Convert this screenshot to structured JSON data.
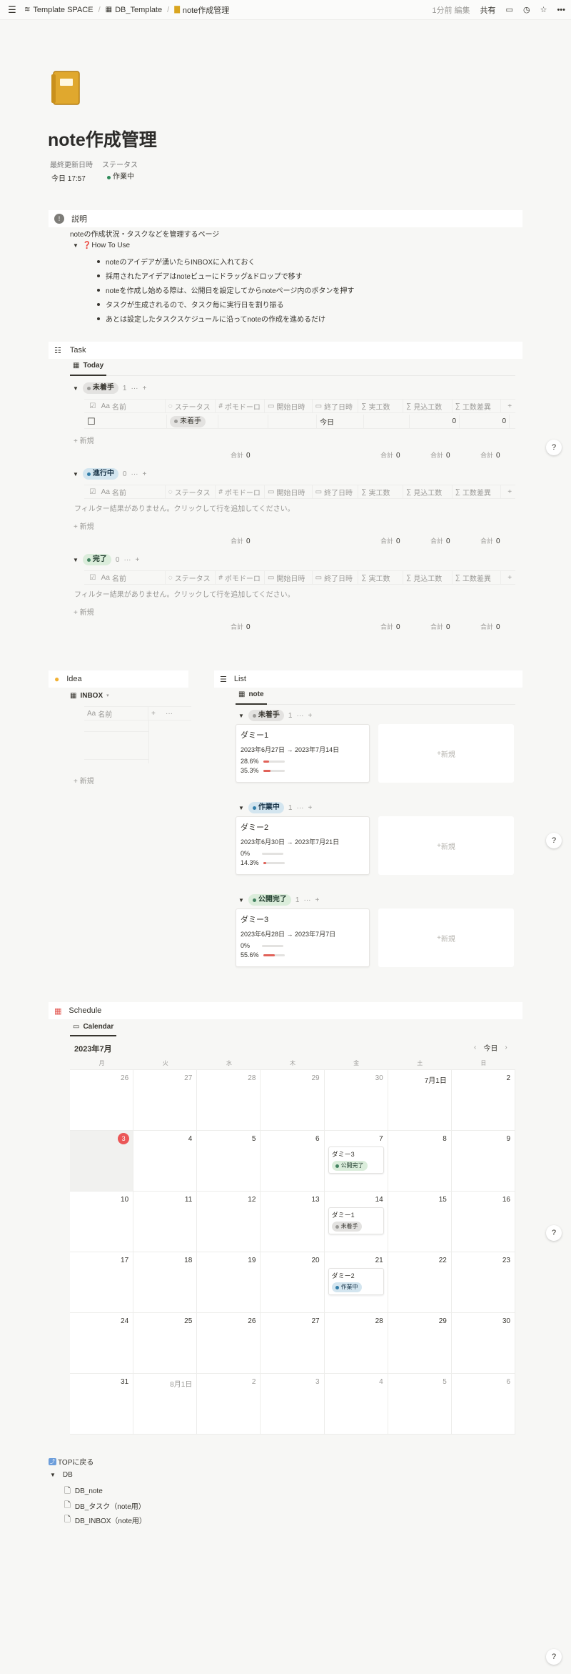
{
  "breadcrumb": {
    "workspace": "Template SPACE",
    "db": "DB_Template",
    "page": "note作成管理"
  },
  "topbar": {
    "edited": "1分前 編集",
    "share": "共有"
  },
  "page": {
    "title": "note作成管理",
    "props": {
      "updated_label": "最終更新日時",
      "status_label": "ステータス",
      "updated_value": "今日 17:57",
      "status_value": "作業中"
    }
  },
  "callout": {
    "heading": "説明",
    "desc": "noteの作成状況・タスクなどを管理するページ",
    "toggle": "❓How To Use",
    "items": [
      "noteのアイデアが湧いたらINBOXに入れておく",
      "採用されたアイデアはnoteビューにドラッグ&ドロップで移す",
      "noteを作成し始める際は、公開日を設定してからnoteページ内のボタンを押す",
      "タスクが生成されるので、タスク毎に実行日を割り振る",
      "あとは設定したタスクスケジュールに沿ってnoteの作成を進めるだけ"
    ]
  },
  "task": {
    "heading": "Task",
    "tab": "Today",
    "columns": [
      "名前",
      "ステータス",
      "ポモドーロ",
      "開始日時",
      "終了日時",
      "実工数",
      "見込工数",
      "工数差異"
    ],
    "groups": [
      {
        "label": "未着手",
        "count": "1",
        "color": "gray",
        "row": {
          "status": "未着手",
          "end": "今日",
          "est": "0",
          "diff": "0"
        },
        "sums": [
          "0",
          "0",
          "0",
          "0"
        ]
      },
      {
        "label": "進行中",
        "count": "0",
        "color": "blue",
        "empty": "フィルター結果がありません。クリックして行を追加してください。",
        "sums": [
          "0",
          "0",
          "0",
          "0"
        ]
      },
      {
        "label": "完了",
        "count": "0",
        "color": "green",
        "empty": "フィルター結果がありません。クリックして行を追加してください。",
        "sums": [
          "0",
          "0",
          "0",
          "0"
        ]
      }
    ],
    "new_label": "新規",
    "sum_label": "合計"
  },
  "idea": {
    "heading": "Idea",
    "tab": "INBOX",
    "col": "名前",
    "new_label": "新規"
  },
  "list": {
    "heading": "List",
    "tab": "note",
    "groups": [
      {
        "label": "未着手",
        "count": "1",
        "color": "gray",
        "card": {
          "name": "ダミー1",
          "dates": "2023年6月27日 → 2023年7月14日",
          "p1": "28.6%",
          "p2": "35.3%",
          "v1": 0.286,
          "v2": 0.353
        }
      },
      {
        "label": "作業中",
        "count": "1",
        "color": "blue",
        "card": {
          "name": "ダミー2",
          "dates": "2023年6月30日 → 2023年7月21日",
          "p1": "0%",
          "p2": "14.3%",
          "v1": 0,
          "v2": 0.143
        }
      },
      {
        "label": "公開完了",
        "count": "1",
        "color": "green",
        "card": {
          "name": "ダミー3",
          "dates": "2023年6月28日 → 2023年7月7日",
          "p1": "0%",
          "p2": "55.6%",
          "v1": 0,
          "v2": 0.556
        }
      }
    ],
    "new_label": "新規"
  },
  "schedule": {
    "heading": "Schedule",
    "tab": "Calendar",
    "month": "2023年7月",
    "today_btn": "今日",
    "weekdays": [
      "月",
      "火",
      "水",
      "木",
      "金",
      "土",
      "日"
    ],
    "days": [
      "26",
      "27",
      "28",
      "29",
      "30",
      "7月1日",
      "2",
      "3",
      "4",
      "5",
      "6",
      "7",
      "8",
      "9",
      "10",
      "11",
      "12",
      "13",
      "14",
      "15",
      "16",
      "17",
      "18",
      "19",
      "20",
      "21",
      "22",
      "23",
      "24",
      "25",
      "26",
      "27",
      "28",
      "29",
      "30",
      "31",
      "8月1日",
      "2",
      "3",
      "4",
      "5",
      "6"
    ],
    "events": {
      "11": {
        "name": "ダミー3",
        "status": "公開完了",
        "color": "green"
      },
      "18": {
        "name": "ダミー1",
        "status": "未着手",
        "color": "gray"
      },
      "25": {
        "name": "ダミー2",
        "status": "作業中",
        "color": "blue"
      }
    }
  },
  "footer": {
    "top_link": "TOPに戻る",
    "toggle": "DB",
    "pages": [
      "DB_note",
      "DB_タスク（note用）",
      "DB_INBOX（note用）"
    ]
  },
  "help": "?"
}
